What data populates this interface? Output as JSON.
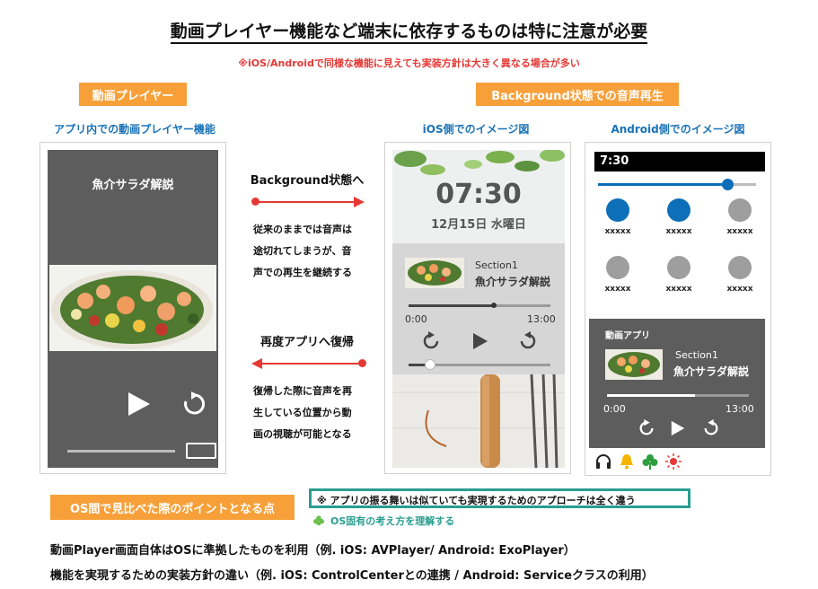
{
  "header": {
    "title": "動画プレイヤー機能など端末に依存するものは特に注意が必要",
    "subtitle": "※iOS/Androidで同様な機能に見えても実装方針は大きく異なる場合が多い"
  },
  "left_section": {
    "tag": "動画プレイヤー",
    "caption": "アプリ内での動画プレイヤー機能",
    "video_title": "魚介サラダ解説"
  },
  "middle": {
    "to_background_label": "Background状態へ",
    "to_background_desc": [
      "従来のままでは音声は",
      "途切れてしまうが、音",
      "声での再生を継続する"
    ],
    "return_label": "再度アプリへ復帰",
    "return_desc": [
      "復帰した際に音声を再",
      "生している位置から動",
      "画の視聴が可能となる"
    ]
  },
  "right_section": {
    "tag": "Background状態での音声再生",
    "ios_caption": "iOS側でのイメージ図",
    "android_caption": "Android側でのイメージ図"
  },
  "ios": {
    "time": "07:30",
    "date": "12月15日 水曜日",
    "section": "Section1",
    "track": "魚介サラダ解説",
    "elapsed": "0:00",
    "duration": "13:00",
    "progress": 0.6,
    "volume": 0.15
  },
  "android": {
    "status_time": "7:30",
    "brightness": 0.82,
    "tiles": [
      "xxxxx",
      "xxxxx",
      "xxxxx",
      "xxxxx",
      "xxxxx",
      "xxxxx"
    ],
    "tile_colors": [
      "#0d6fb8",
      "#0d6fb8",
      "#9e9e9e",
      "#9e9e9e",
      "#9e9e9e",
      "#9e9e9e"
    ],
    "app_label": "動画アプリ",
    "section": "Section1",
    "track": "魚介サラダ解説",
    "elapsed": "0:00",
    "duration": "13:00",
    "progress": 0.62
  },
  "bottom": {
    "points_tag": "OS間で見比べた際のポイントとなる点",
    "note_box": "※ アプリの振る舞いは似ていても実現するためのアプローチは全く違う",
    "clover_note": "OS固有の考え方を理解する",
    "line1": "動画Player画面自体はOSに準拠したものを利用（例. iOS: AVPlayer/ Android: ExoPlayer）",
    "line2": "機能を実現するための実装方針の違い（例. iOS: ControlCenterとの連携 / Android: Serviceクラスの利用）"
  },
  "colors": {
    "accent_orange": "#f7a03a",
    "caption_blue": "#1a73b8",
    "arrow_red": "#e53935",
    "note_teal": "#2a9d8f"
  }
}
